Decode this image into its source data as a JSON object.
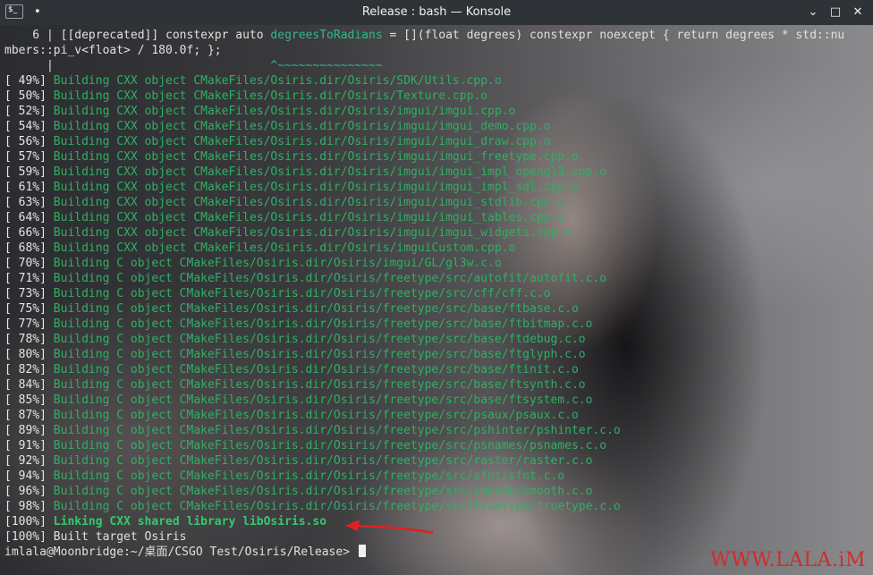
{
  "window": {
    "title": "Release : bash — Konsole",
    "menu_icon": "$_",
    "pin_icon": "pin-icon"
  },
  "controls": {
    "minimize": "⌄",
    "maximize": "□",
    "close": "✕"
  },
  "terminal": {
    "warning": {
      "line1": "    6 | [[deprecated]] constexpr auto ",
      "fn": "degreesToRadians",
      "line1b": " = [](float degrees) constexpr noexcept { return degrees * std::nu",
      "line2": "mbers::pi_v<float> / 180.0f; };",
      "bar": "      |",
      "tilde_pad": "                               ",
      "tilde": "^~~~~~~~~~~~~~~~"
    },
    "build_lines": [
      {
        "pct": "[ 49%]",
        "msg": "Building CXX object CMakeFiles/Osiris.dir/Osiris/SDK/Utils.cpp.o"
      },
      {
        "pct": "[ 50%]",
        "msg": "Building CXX object CMakeFiles/Osiris.dir/Osiris/Texture.cpp.o"
      },
      {
        "pct": "[ 52%]",
        "msg": "Building CXX object CMakeFiles/Osiris.dir/Osiris/imgui/imgui.cpp.o"
      },
      {
        "pct": "[ 54%]",
        "msg": "Building CXX object CMakeFiles/Osiris.dir/Osiris/imgui/imgui_demo.cpp.o"
      },
      {
        "pct": "[ 56%]",
        "msg": "Building CXX object CMakeFiles/Osiris.dir/Osiris/imgui/imgui_draw.cpp.o"
      },
      {
        "pct": "[ 57%]",
        "msg": "Building CXX object CMakeFiles/Osiris.dir/Osiris/imgui/imgui_freetype.cpp.o"
      },
      {
        "pct": "[ 59%]",
        "msg": "Building CXX object CMakeFiles/Osiris.dir/Osiris/imgui/imgui_impl_opengl3.cpp.o"
      },
      {
        "pct": "[ 61%]",
        "msg": "Building CXX object CMakeFiles/Osiris.dir/Osiris/imgui/imgui_impl_sdl.cpp.o"
      },
      {
        "pct": "[ 63%]",
        "msg": "Building CXX object CMakeFiles/Osiris.dir/Osiris/imgui/imgui_stdlib.cpp.o"
      },
      {
        "pct": "[ 64%]",
        "msg": "Building CXX object CMakeFiles/Osiris.dir/Osiris/imgui/imgui_tables.cpp.o"
      },
      {
        "pct": "[ 66%]",
        "msg": "Building CXX object CMakeFiles/Osiris.dir/Osiris/imgui/imgui_widgets.cpp.o"
      },
      {
        "pct": "[ 68%]",
        "msg": "Building CXX object CMakeFiles/Osiris.dir/Osiris/imguiCustom.cpp.o"
      },
      {
        "pct": "[ 70%]",
        "msg": "Building C object CMakeFiles/Osiris.dir/Osiris/imgui/GL/gl3w.c.o"
      },
      {
        "pct": "[ 71%]",
        "msg": "Building C object CMakeFiles/Osiris.dir/Osiris/freetype/src/autofit/autofit.c.o"
      },
      {
        "pct": "[ 73%]",
        "msg": "Building C object CMakeFiles/Osiris.dir/Osiris/freetype/src/cff/cff.c.o"
      },
      {
        "pct": "[ 75%]",
        "msg": "Building C object CMakeFiles/Osiris.dir/Osiris/freetype/src/base/ftbase.c.o"
      },
      {
        "pct": "[ 77%]",
        "msg": "Building C object CMakeFiles/Osiris.dir/Osiris/freetype/src/base/ftbitmap.c.o"
      },
      {
        "pct": "[ 78%]",
        "msg": "Building C object CMakeFiles/Osiris.dir/Osiris/freetype/src/base/ftdebug.c.o"
      },
      {
        "pct": "[ 80%]",
        "msg": "Building C object CMakeFiles/Osiris.dir/Osiris/freetype/src/base/ftglyph.c.o"
      },
      {
        "pct": "[ 82%]",
        "msg": "Building C object CMakeFiles/Osiris.dir/Osiris/freetype/src/base/ftinit.c.o"
      },
      {
        "pct": "[ 84%]",
        "msg": "Building C object CMakeFiles/Osiris.dir/Osiris/freetype/src/base/ftsynth.c.o"
      },
      {
        "pct": "[ 85%]",
        "msg": "Building C object CMakeFiles/Osiris.dir/Osiris/freetype/src/base/ftsystem.c.o"
      },
      {
        "pct": "[ 87%]",
        "msg": "Building C object CMakeFiles/Osiris.dir/Osiris/freetype/src/psaux/psaux.c.o"
      },
      {
        "pct": "[ 89%]",
        "msg": "Building C object CMakeFiles/Osiris.dir/Osiris/freetype/src/pshinter/pshinter.c.o"
      },
      {
        "pct": "[ 91%]",
        "msg": "Building C object CMakeFiles/Osiris.dir/Osiris/freetype/src/psnames/psnames.c.o"
      },
      {
        "pct": "[ 92%]",
        "msg": "Building C object CMakeFiles/Osiris.dir/Osiris/freetype/src/raster/raster.c.o"
      },
      {
        "pct": "[ 94%]",
        "msg": "Building C object CMakeFiles/Osiris.dir/Osiris/freetype/src/sfnt/sfnt.c.o"
      },
      {
        "pct": "[ 96%]",
        "msg": "Building C object CMakeFiles/Osiris.dir/Osiris/freetype/src/smooth/smooth.c.o"
      },
      {
        "pct": "[ 98%]",
        "msg": "Building C object CMakeFiles/Osiris.dir/Osiris/freetype/src/truetype/truetype.c.o"
      }
    ],
    "link_line": {
      "pct": "[100%]",
      "msg": "Linking CXX shared library libOsiris.so"
    },
    "built_line": "[100%] Built target Osiris",
    "prompt": "imlala@Moonbridge:~/桌面/CSGO Test/Osiris/Release> "
  },
  "annotation": {
    "arrow_color": "#e02020"
  },
  "watermark": "WWW.LALA.iM"
}
